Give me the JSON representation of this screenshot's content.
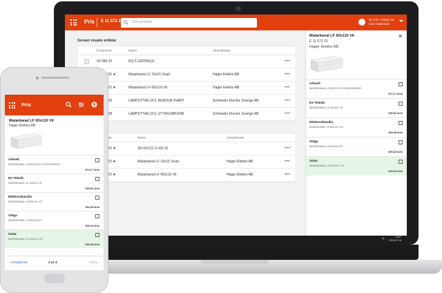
{
  "desktop": {
    "header": {
      "app_title": "Pris",
      "enumber": "E 11 572 20",
      "search_placeholder": "Sök produkt",
      "user_line1": "EL-Info i Växjö AB",
      "user_line2": "Karl Andersson"
    },
    "recent": {
      "title": "Senast visade artiklar",
      "headers": {
        "enumber": "E-Nummer",
        "name": "Namn",
        "owner": "Ämnehavare"
      },
      "rows": [
        {
          "enumber": "03 586 20",
          "starred": false,
          "name": "RQ 6 GRÖNGUL",
          "owner": ""
        },
        {
          "enumber": "11 553 83",
          "starred": true,
          "name": "Matarkanal LF 15x15 Svart",
          "owner": "Hager Elektro AB"
        },
        {
          "enumber": "11 572 20",
          "starred": true,
          "name": "Matarkanal LF 60x110 Vit",
          "owner": "Hager Elektro AB"
        },
        {
          "enumber": "13 262 05",
          "starred": false,
          "name": "LAMPUTTAG DCL RENOVA SVART",
          "owner": "Schneider Electric Sverige AB"
        },
        {
          "enumber": "13 262 08",
          "starred": false,
          "name": "LAMPUTTAG DCL UTTAGSBRUNN",
          "owner": "Schneider Electric Sverige AB"
        }
      ]
    },
    "favorites": {
      "headers": {
        "enumber": "E-Nummer",
        "name": "Namn",
        "owner": "Ämnehavare"
      },
      "rows": [
        {
          "enumber": "11 528 20",
          "starred": true,
          "name": "SE-N1XZ1-U 4G 10",
          "owner": ""
        },
        {
          "enumber": "11 553 83",
          "starred": true,
          "name": "Matarkanal LF 15x15 Svart",
          "owner": "Hager Elektro AB"
        },
        {
          "enumber": "11 572 20",
          "starred": true,
          "name": "Matarkanal LF 60x110 Vit",
          "owner": "Hager Elektro AB"
        }
      ]
    },
    "panel": {
      "title": "Matarkanal LF 60x110 Vit",
      "enumber": "E 11 572 20",
      "brand": "Hager Elektro AB",
      "suppliers": [
        {
          "name": "Ahlsell",
          "desc": "MATARKANAL LF 60X110 VIT,LF60110009010",
          "price": "372,17 kr/m",
          "selected": false
        },
        {
          "name": "E2 Teknik",
          "desc": "MATARKANAL LF, 60X110, vit",
          "price": "239,51 kr/m",
          "selected": false
        },
        {
          "name": "Elektroskandia",
          "desc": "MATARKANAL LF 60X110, VIT",
          "price": "254,39 kr/m",
          "selected": false
        },
        {
          "name": "Selga",
          "desc": "MATARKANAL LF 60X110 VIT",
          "price": "305,32 kr/m",
          "selected": false
        },
        {
          "name": "Solar",
          "desc": "MATARKANAL LF, 60X110, VIT",
          "price": "226,30 kr/m",
          "selected": true
        }
      ]
    },
    "taskbar": {
      "time": "14:07",
      "date": "2018-07-16"
    }
  },
  "mobile": {
    "header": {
      "app_title": "Pris"
    },
    "product": {
      "title": "Matarkanal LF 60x110 Vit",
      "brand": "Hager Elektro AB"
    },
    "suppliers": [
      {
        "name": "Ahlsell",
        "desc": "MATARKANAL LF 60X110 VIT,LF60110009010",
        "price": "372,17 kr/m",
        "selected": false
      },
      {
        "name": "E2 Teknik",
        "desc": "MATARKANAL LF, 60X110, vit",
        "price": "239,51 kr/m",
        "selected": false
      },
      {
        "name": "Elektroskandia",
        "desc": "MATARKANAL LF 60X110, VIT",
        "price": "254,39 kr/m",
        "selected": false
      },
      {
        "name": "Selga",
        "desc": "MATARKANAL LF 60X110 VIT",
        "price": "305,32 kr/m",
        "selected": false
      },
      {
        "name": "Solar",
        "desc": "MATARKANAL LF, 60X110, VIT",
        "price": "226,30 kr/m",
        "selected": true
      }
    ],
    "pager": {
      "prev": "Föregående",
      "count": "2 av 3",
      "next": "Nästa"
    }
  },
  "colors": {
    "brand": "#e2400f",
    "selected_row": "#e6f6e6",
    "link": "#2a6fd6"
  }
}
